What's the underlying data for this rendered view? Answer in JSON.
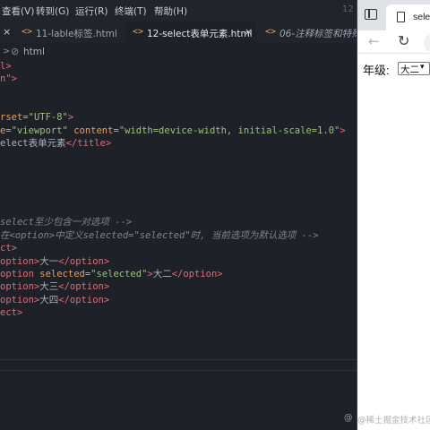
{
  "editor": {
    "menu": [
      "查看(V)",
      "转到(G)",
      "运行(R)",
      "终端(T)",
      "帮助(H)"
    ],
    "menu_time": "12",
    "tabs": [
      {
        "label": "11-lable标签.html",
        "active": false
      },
      {
        "label": "12-select表单元素.html",
        "active": true
      },
      {
        "label": "06-注释标签和特殊",
        "active": false
      }
    ],
    "close_icon": "×",
    "breadcrumb": {
      "item": "html"
    },
    "lines": [
      {
        "parts": [
          [
            "c-tag",
            "l>"
          ]
        ]
      },
      {
        "parts": [
          [
            "c-tag",
            "n\">"
          ]
        ]
      },
      {
        "parts": []
      },
      {
        "parts": [
          [
            "c-attr",
            "rset"
          ],
          [
            "c-text",
            "="
          ],
          [
            "c-str",
            "\"UTF-8\""
          ],
          [
            "c-tag",
            ">"
          ]
        ]
      },
      {
        "parts": [
          [
            "c-attr",
            "e"
          ],
          [
            "c-text",
            "="
          ],
          [
            "c-str",
            "\"viewport\""
          ],
          [
            "c-text",
            " "
          ],
          [
            "c-attr",
            "content"
          ],
          [
            "c-text",
            "="
          ],
          [
            "c-str",
            "\"width=device-width, initial-scale=1.0\""
          ],
          [
            "c-tag",
            ">"
          ]
        ]
      },
      {
        "parts": [
          [
            "c-text",
            "elect表单元素"
          ],
          [
            "c-tag",
            "</title>"
          ]
        ]
      },
      {
        "parts": []
      },
      {
        "parts": []
      },
      {
        "parts": []
      },
      {
        "parts": []
      },
      {
        "parts": []
      },
      {
        "parts": [
          [
            "c-comment",
            "select至少包含一对选项 -->"
          ]
        ]
      },
      {
        "parts": [
          [
            "c-comment",
            "在<option>中定义selected=\"selected\"时, 当前选项为默认选项 -->"
          ]
        ]
      },
      {
        "parts": [
          [
            "c-tag",
            "ct>"
          ]
        ]
      },
      {
        "parts": [
          [
            "c-tag",
            "option>"
          ],
          [
            "c-text",
            "大一"
          ],
          [
            "c-tag",
            "</option>"
          ]
        ]
      },
      {
        "parts": [
          [
            "c-tag",
            "option "
          ],
          [
            "c-attr",
            "selected"
          ],
          [
            "c-text",
            "="
          ],
          [
            "c-str",
            "\"selected\""
          ],
          [
            "c-tag",
            ">"
          ],
          [
            "c-text",
            "大二"
          ],
          [
            "c-tag",
            "</option>"
          ]
        ]
      },
      {
        "parts": [
          [
            "c-tag",
            "option>"
          ],
          [
            "c-text",
            "大三"
          ],
          [
            "c-tag",
            "</option>"
          ]
        ]
      },
      {
        "parts": [
          [
            "c-tag",
            "option>"
          ],
          [
            "c-text",
            "大四"
          ],
          [
            "c-tag",
            "</option>"
          ]
        ]
      },
      {
        "parts": [
          [
            "c-tag",
            "ect>"
          ]
        ]
      }
    ]
  },
  "browser": {
    "tab_title": "selec",
    "grade_label": "年级:",
    "select_value": "大二",
    "select_arrow": "▾",
    "back_icon": "←",
    "refresh_icon": "↻"
  },
  "watermark": "@稀土掘金技术社区",
  "watermark_left": "@"
}
